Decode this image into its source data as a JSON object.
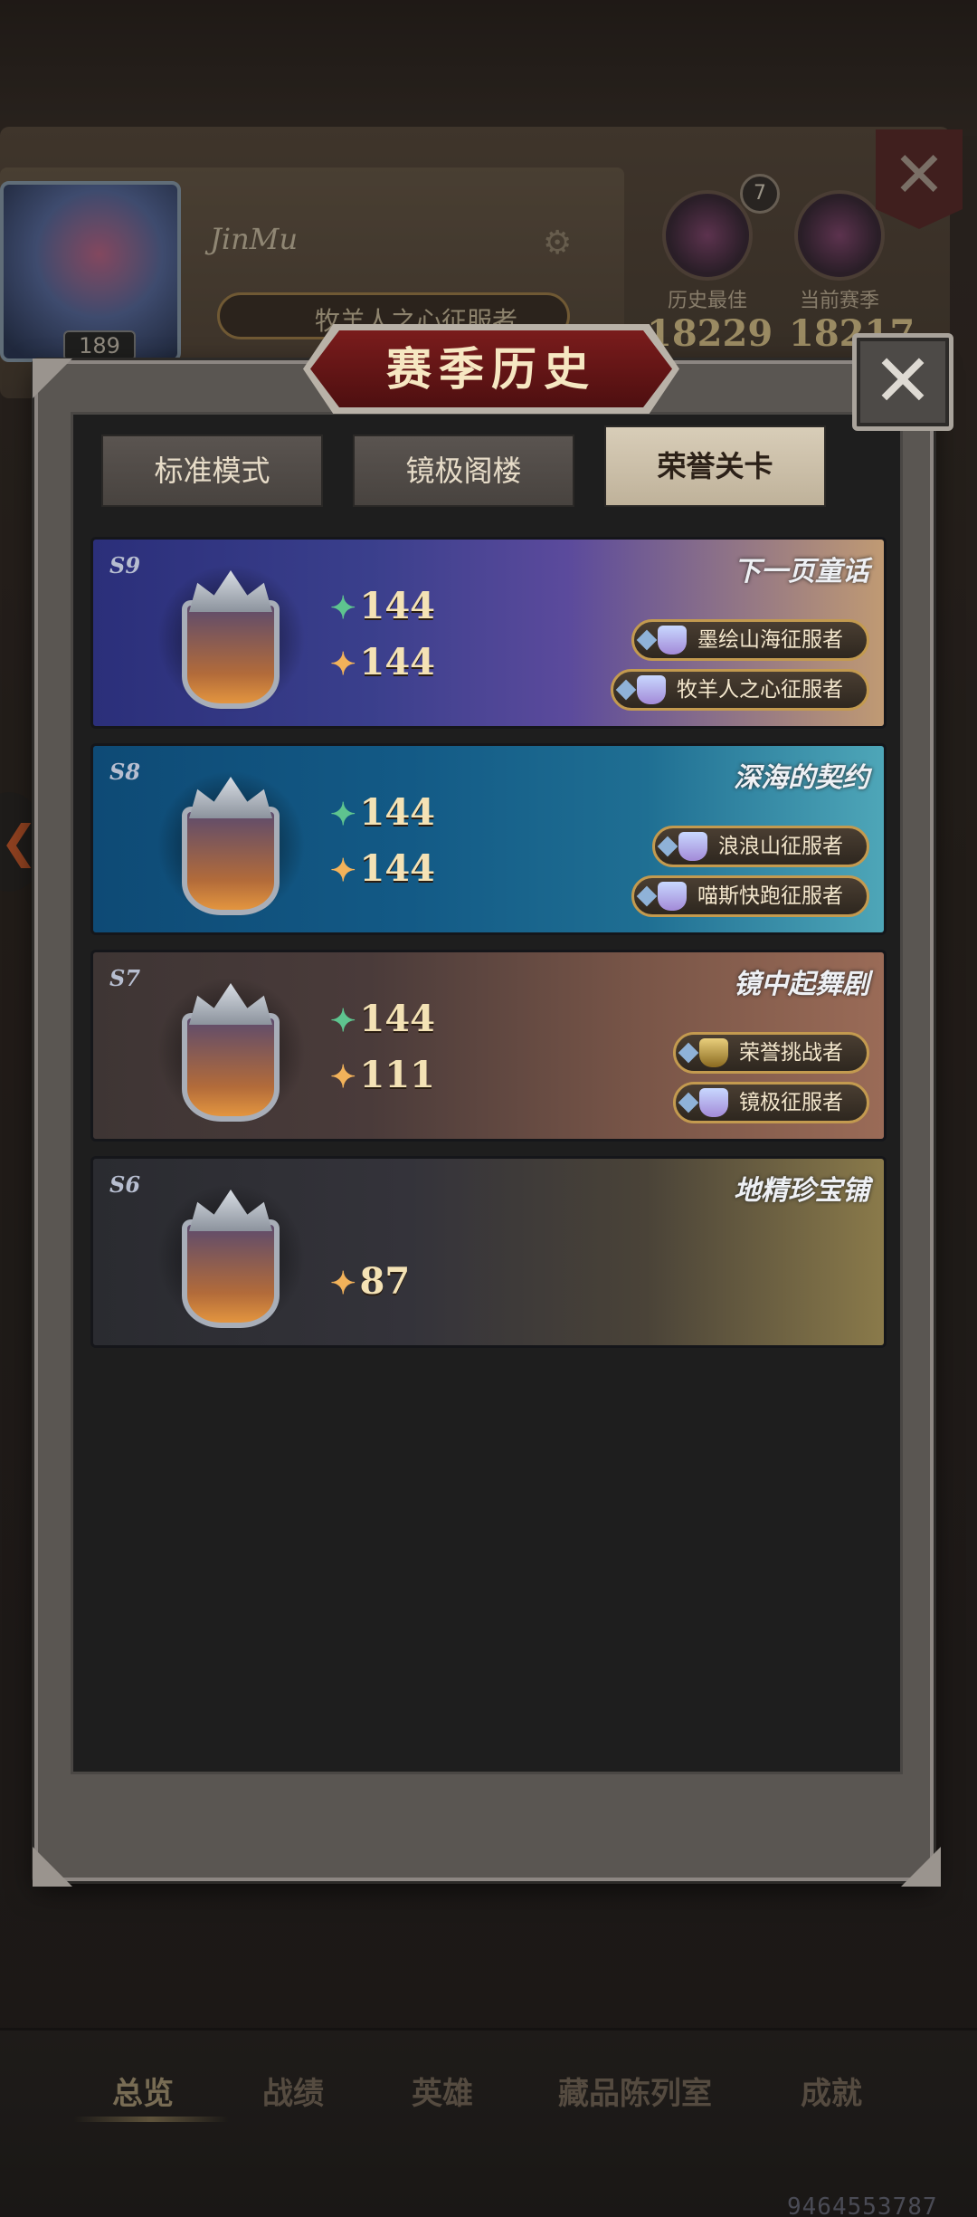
{
  "profile": {
    "player_name": "JinMu",
    "level": "189",
    "title_badge": "牧羊人之心征服者",
    "rank_level": "7",
    "best": {
      "label": "历史最佳",
      "score": "18229"
    },
    "current": {
      "label": "当前赛季",
      "score": "18217"
    }
  },
  "dialog": {
    "title": "赛季历史",
    "tabs": [
      {
        "label": "标准模式",
        "active": false
      },
      {
        "label": "镜极阁楼",
        "active": false
      },
      {
        "label": "荣誉关卡",
        "active": true
      }
    ],
    "seasons": [
      {
        "tag": "S9",
        "name": "下一页童话",
        "green_stat": "144",
        "gold_stat": "144",
        "rewards": [
          "墨绘山海征服者",
          "牧羊人之心征服者"
        ],
        "reward_icons": [
          "silver-cup-icon",
          "silver-cup-icon"
        ],
        "art_colors": [
          "#2b2f7a",
          "#5b4a9c",
          "#c09a73"
        ]
      },
      {
        "tag": "S8",
        "name": "深海的契约",
        "green_stat": "144",
        "gold_stat": "144",
        "rewards": [
          "浪浪山征服者",
          "喵斯快跑征服者"
        ],
        "reward_icons": [
          "silver-cup-icon",
          "silver-cup-icon"
        ],
        "art_colors": [
          "#0e4a75",
          "#1f6f93",
          "#4ea6b8"
        ]
      },
      {
        "tag": "S7",
        "name": "镜中起舞剧",
        "green_stat": "144",
        "gold_stat": "111",
        "rewards": [
          "荣誉挑战者",
          "镜极征服者"
        ],
        "reward_icons": [
          "gold-cup-icon",
          "silver-cup-icon"
        ],
        "art_colors": [
          "#4a3b3a",
          "#7a5648",
          "#9a6b57"
        ]
      },
      {
        "tag": "S6",
        "name": "地精珍宝铺",
        "green_stat": "",
        "gold_stat": "87",
        "rewards": [],
        "reward_icons": [],
        "art_colors": [
          "#2a2b30",
          "#4a4338",
          "#8a7a4a"
        ]
      }
    ]
  },
  "bottom_nav": [
    {
      "label": "总览",
      "active": true
    },
    {
      "label": "战绩",
      "active": false
    },
    {
      "label": "英雄",
      "active": false
    },
    {
      "label": "藏品陈列室",
      "active": false
    },
    {
      "label": "成就",
      "active": false
    }
  ],
  "uid": "9464553787"
}
